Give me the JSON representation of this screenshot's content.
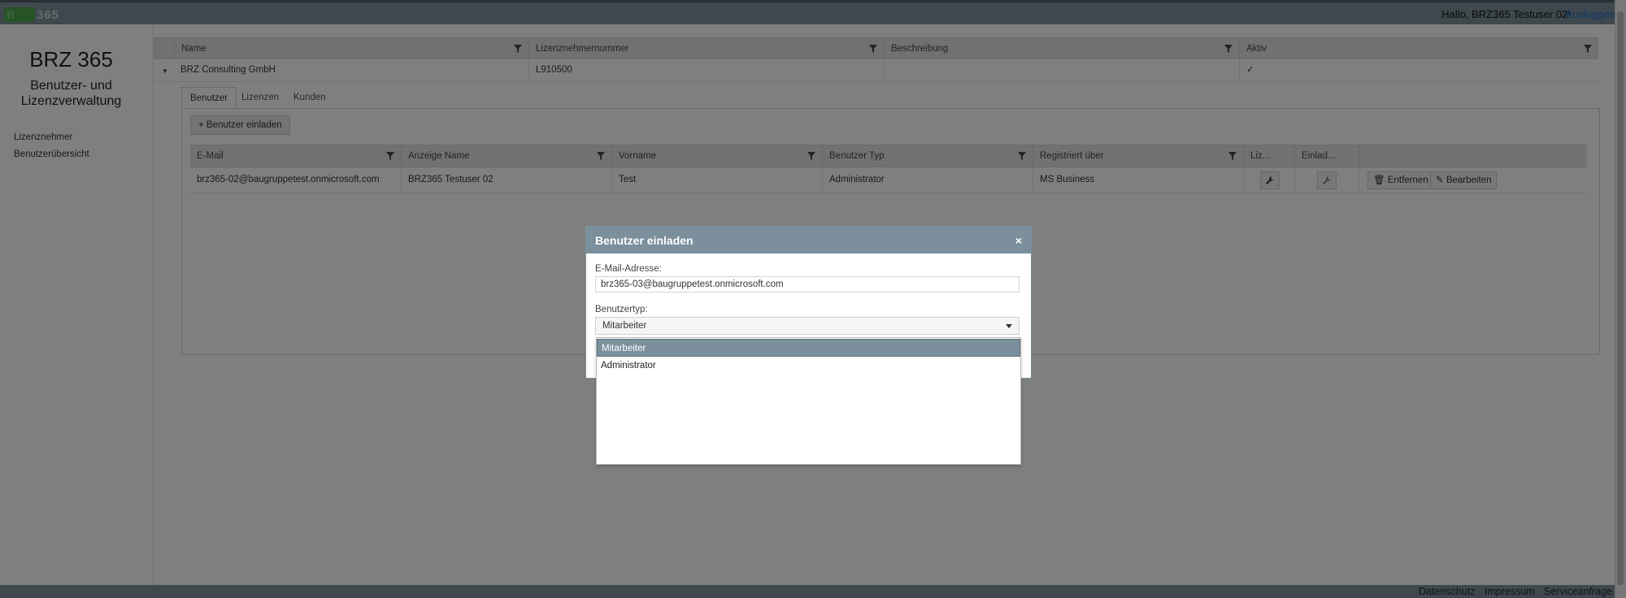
{
  "header": {
    "logo_text": "365",
    "greeting": "Hallo, BRZ365 Testuser 02!",
    "logout": "Ausloggen"
  },
  "sidebar": {
    "title": "BRZ 365",
    "subtitle_line1": "Benutzer- und",
    "subtitle_line2": "Lizenzverwaltung",
    "items": [
      {
        "label": "Lizenznehmer"
      },
      {
        "label": "Benutzerübersicht"
      }
    ]
  },
  "grid": {
    "columns": [
      "Name",
      "Lizenznehmernummer",
      "Beschreibung",
      "Aktiv"
    ],
    "row": {
      "name": "BRZ Consulting GmbH",
      "number": "L910500",
      "description": "",
      "active": "✓"
    }
  },
  "detail": {
    "tabs": [
      "Benutzer",
      "Lizenzen",
      "Kunden"
    ],
    "active_tab": "Benutzer",
    "invite_button": "Benutzer einladen",
    "columns": [
      "E-Mail",
      "Anzeige Name",
      "Vorname",
      "Benutzer Typ",
      "Registriert über",
      "Liz...",
      "Einlad..."
    ],
    "rows": [
      {
        "email": "brz365-02@baugruppetest.onmicrosoft.com",
        "display_name": "BRZ365 Testuser 02",
        "first_name": "Test",
        "user_type": "Administrator",
        "registered_via": "MS Business",
        "remove_label": "Entfernen",
        "edit_label": "Bearbeiten"
      }
    ]
  },
  "modal": {
    "title": "Benutzer einladen",
    "close": "×",
    "email_label": "E-Mail-Adresse:",
    "email_value": "brz365-03@baugruppetest.onmicrosoft.com",
    "type_label": "Benutzertyp:",
    "type_value": "Mitarbeiter",
    "options": [
      "Mitarbeiter",
      "Administrator"
    ],
    "selected_option": "Mitarbeiter"
  },
  "footer": {
    "links": [
      "Datenschutz",
      "Impressum",
      "Serviceanfrage"
    ]
  },
  "colors": {
    "bar": "#7d909b",
    "modal_header": "#7b8f9c",
    "link": "#1f6fd1"
  }
}
